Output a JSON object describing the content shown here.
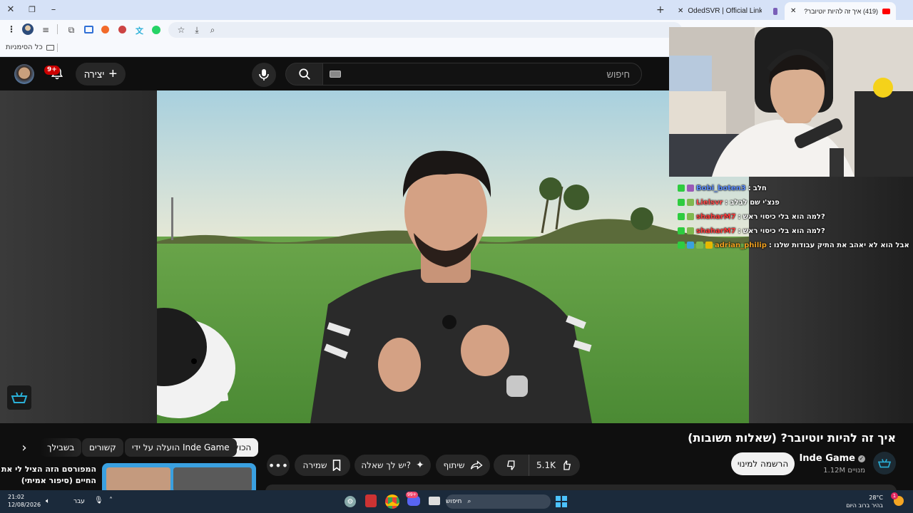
{
  "browser": {
    "tabs": [
      {
        "title": "(419) איך זה להיות יוטיובר?",
        "active": true
      },
      {
        "title": "",
        "active": false
      },
      {
        "title": "OdedSVR | Official Links",
        "active": false
      }
    ],
    "bookmarks_label": "כל הסימניות"
  },
  "youtube": {
    "search_placeholder": "חיפוש",
    "create_label": "יצירה",
    "notif_count": "9+"
  },
  "chat": [
    {
      "user": "Bobi_boten3",
      "user_color": "#5b8cff",
      "message": "חלב",
      "msg_color": "#ffffff"
    },
    {
      "user": "Lielsvr",
      "user_color": "#ff4d4d",
      "message": "פנצ'י שם לבלב",
      "msg_color": "#ffffff"
    },
    {
      "user": "shaharM7",
      "user_color": "#ff3b3b",
      "message": "?למה הוא בלי כיסוי ראש",
      "msg_color": "#ffffff"
    },
    {
      "user": "shaharM7",
      "user_color": "#ff3b3b",
      "message": "?למה הוא בלי כיסוי ראש",
      "msg_color": "#ffffff"
    },
    {
      "user": "adrian_philip",
      "user_color": "#f0a020",
      "message": "אבל הוא לא יאהב את התיק עבודות שלנו",
      "msg_color": "#ffffff"
    }
  ],
  "video": {
    "title": "איך זה להיות יוטיובר? (שאלות תשובות)",
    "channel": "Inde Game",
    "subscribers": "1.12M מנויים",
    "subscribe_label": "הרשמה למינוי",
    "likes": "5.1K",
    "share_label": "שיתוף",
    "ask_label": "יש לך שאלה?",
    "save_label": "שמירה"
  },
  "chips": [
    "הכול",
    "הועלה על ידי Inde Game",
    "קשורים",
    "בשבילך"
  ],
  "recommendation": {
    "title_line1": "המפורסם הזה הציל לי את",
    "title_line2": "החיים (סיפור אמיתי)"
  },
  "taskbar": {
    "weather_temp": "28°C",
    "weather_text": "בהיר ברוב היום",
    "search_label": "חיפוש",
    "lang": "עבר",
    "time": "21:02",
    "date": "12/08/2026",
    "discord_badge": "99+",
    "weather_badge": "1"
  }
}
